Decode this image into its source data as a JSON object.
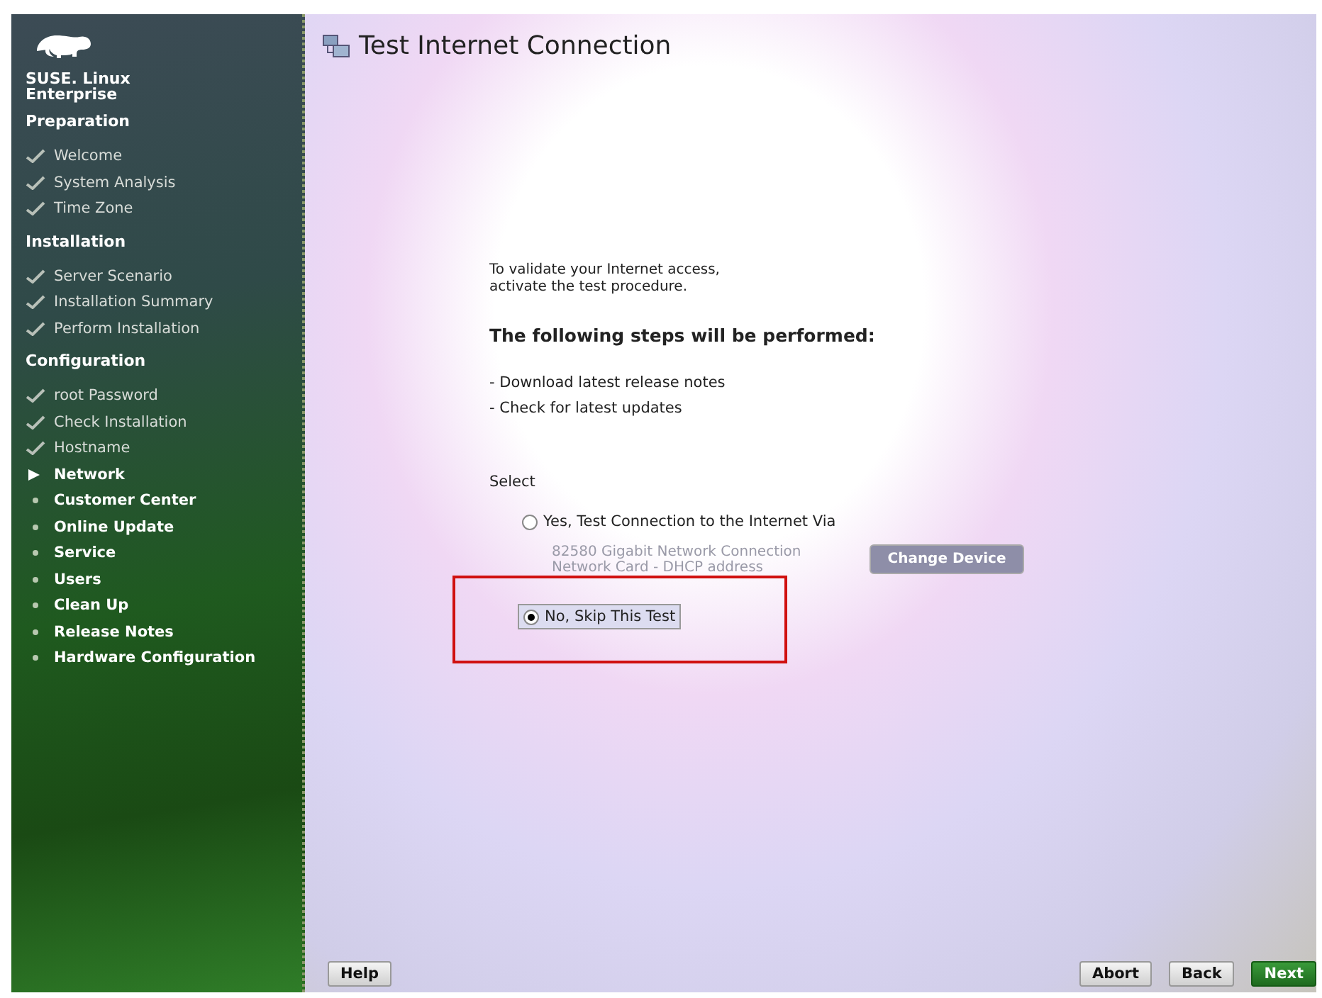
{
  "brand": {
    "line1": "SUSE. Linux",
    "line2": "Enterprise"
  },
  "sidebar": [
    {
      "title": "Preparation",
      "items": [
        {
          "label": "Welcome",
          "kind": "done"
        },
        {
          "label": "System Analysis",
          "kind": "done"
        },
        {
          "label": "Time Zone",
          "kind": "done"
        }
      ]
    },
    {
      "title": "Installation",
      "items": [
        {
          "label": "Server Scenario",
          "kind": "done"
        },
        {
          "label": "Installation Summary",
          "kind": "done"
        },
        {
          "label": "Perform Installation",
          "kind": "done"
        }
      ]
    },
    {
      "title": "Configuration",
      "items": [
        {
          "label": "root Password",
          "kind": "done"
        },
        {
          "label": "Check Installation",
          "kind": "done"
        },
        {
          "label": "Hostname",
          "kind": "done"
        },
        {
          "label": "Network",
          "kind": "current"
        },
        {
          "label": "Customer Center",
          "kind": "pending"
        },
        {
          "label": "Online Update",
          "kind": "pending"
        },
        {
          "label": "Service",
          "kind": "pending"
        },
        {
          "label": "Users",
          "kind": "pending"
        },
        {
          "label": "Clean Up",
          "kind": "pending"
        },
        {
          "label": "Release Notes",
          "kind": "pending"
        },
        {
          "label": "Hardware Configuration",
          "kind": "pending"
        }
      ]
    }
  ],
  "page": {
    "title": "Test Internet Connection",
    "intro": [
      "To validate your Internet access,",
      "activate the test procedure."
    ],
    "steps_heading": "The following steps will be performed:",
    "steps": [
      "- Download latest release notes",
      "- Check for latest updates"
    ],
    "select_label": "Select",
    "options": [
      {
        "label": "Yes, Test Connection to the Internet Via",
        "selected": false,
        "highlighted": false,
        "device": [
          "82580 Gigabit Network Connection",
          "Network Card - DHCP address"
        ],
        "device_button": {
          "label": "Change Device",
          "disabled": true
        }
      },
      {
        "label": "No, Skip This Test",
        "selected": true,
        "highlighted": true
      }
    ]
  },
  "buttons": {
    "help": "Help",
    "abort": "Abort",
    "back": "Back",
    "next": "Next"
  }
}
